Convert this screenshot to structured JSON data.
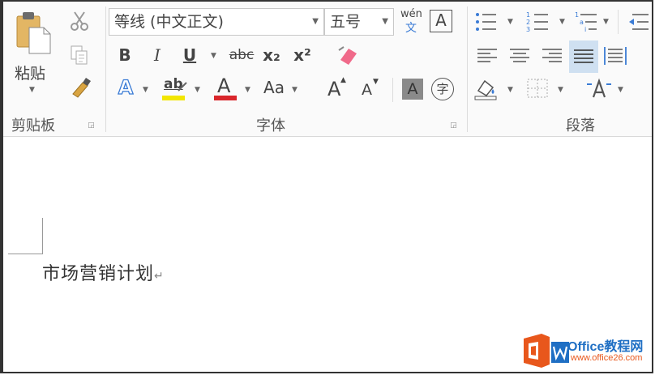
{
  "clipboard": {
    "paste_label": "粘贴",
    "group_label": "剪贴板"
  },
  "font": {
    "font_name": "等线 (中文正文)",
    "font_size": "五号",
    "phonetic_top": "wén",
    "phonetic_bottom": "文",
    "char_border": "A",
    "bold": "B",
    "italic": "I",
    "underline": "U",
    "strike": "abc",
    "subscript": "x₂",
    "superscript": "x²",
    "text_effects": "A",
    "highlight": "ab",
    "font_color": "A",
    "change_case": "Aa",
    "grow": "A",
    "shrink": "A",
    "shading": "A",
    "enclose": "字",
    "group_label": "字体"
  },
  "paragraph": {
    "group_label": "段落"
  },
  "document": {
    "text": "市场营销计划",
    "para_mark": "↵"
  },
  "watermark": {
    "brand": "Office教程网",
    "url": "www.office26.com"
  },
  "colors": {
    "highlight_yellow": "#f2e600",
    "font_red": "#d9262b",
    "effects_blue": "#3a7bd5",
    "justify_active": "#cfe0f1",
    "logo_orange": "#e8571c",
    "logo_blue": "#1f6fc4"
  }
}
